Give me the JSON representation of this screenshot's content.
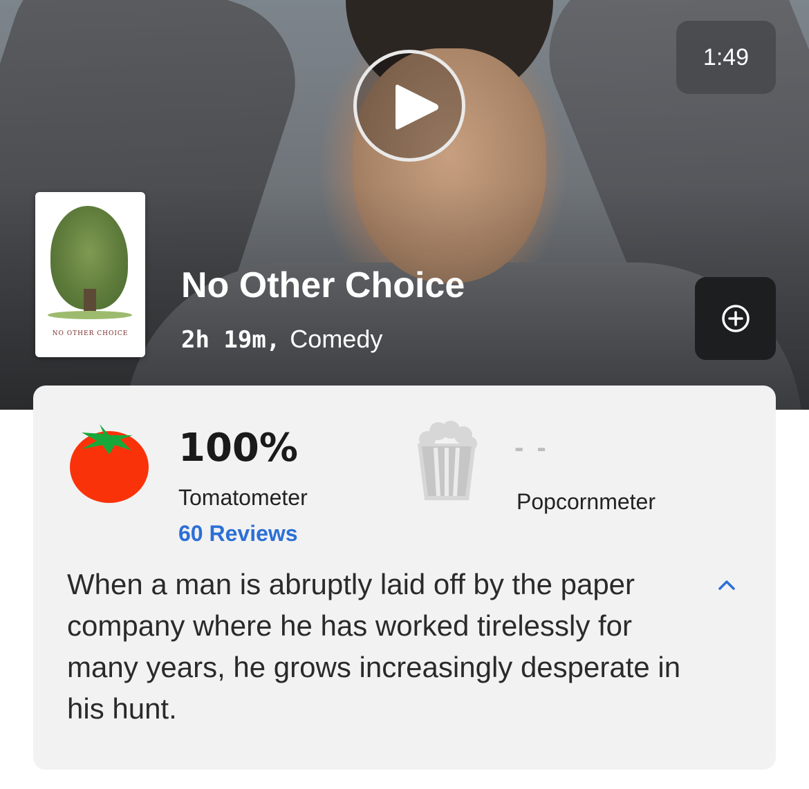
{
  "video": {
    "duration": "1:49"
  },
  "movie": {
    "title": "No Other Choice",
    "runtime": "2h 19m,",
    "genre": "Comedy",
    "poster_title": "NO OTHER CHOICE"
  },
  "scores": {
    "tomatometer_value": "100%",
    "tomatometer_label": "Tomatometer",
    "reviews_label": "60 Reviews",
    "popcornmeter_value": "- -",
    "popcornmeter_label": "Popcornmeter"
  },
  "synopsis": "When a man is abruptly laid off by the paper company where he has worked tirelessly for many years, he grows increasingly desperate in his hunt.",
  "icons": {
    "play": "play-icon",
    "add": "plus-circle-icon",
    "tomato": "tomato-icon",
    "popcorn": "popcorn-icon",
    "collapse": "chevron-up-icon"
  },
  "colors": {
    "link": "#2c6fd6",
    "tomato": "#fa320a",
    "card_bg": "#f2f2f2"
  }
}
